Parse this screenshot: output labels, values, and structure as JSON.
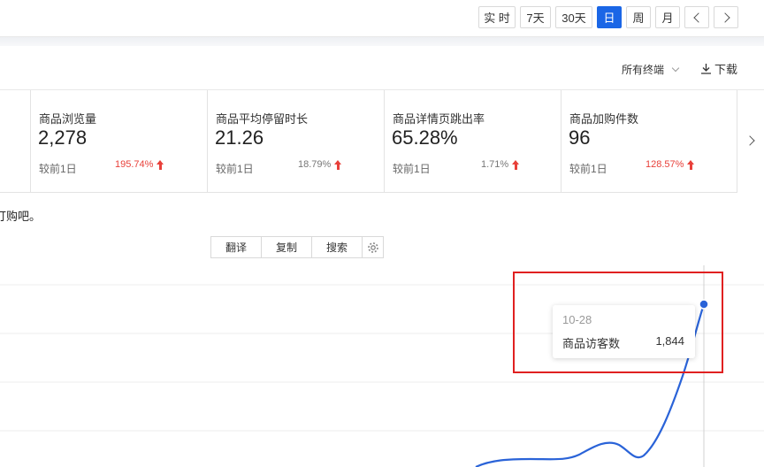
{
  "period_tabs": [
    {
      "label": "实 时",
      "active": false
    },
    {
      "label": "7天",
      "active": false
    },
    {
      "label": "30天",
      "active": false
    },
    {
      "label": "日",
      "active": true
    },
    {
      "label": "周",
      "active": false
    },
    {
      "label": "月",
      "active": false
    }
  ],
  "toolbar": {
    "terminal_select": "所有终端",
    "download_label": "下载"
  },
  "metrics": [
    {
      "title": "商品浏览量",
      "value": "2,278",
      "compare_label": "较前1日",
      "change": "195.74%",
      "trend": "up",
      "change_color": "#e8403a"
    },
    {
      "title": "商品平均停留时长",
      "value": "21.26",
      "compare_label": "较前1日",
      "change": "18.79%",
      "trend": "up",
      "change_color": "#777777"
    },
    {
      "title": "商品详情页跳出率",
      "value": "65.28%",
      "compare_label": "较前1日",
      "change": "1.71%",
      "trend": "up",
      "change_color": "#777777"
    },
    {
      "title": "商品加购件数",
      "value": "96",
      "compare_label": "较前1日",
      "change": "128.57%",
      "trend": "up",
      "change_color": "#e8403a"
    }
  ],
  "text_fragment": "订购吧。",
  "translate_bar": {
    "translate_label": "翻译",
    "copy_label": "复制",
    "search_label": "搜索"
  },
  "tooltip": {
    "date": "10-28",
    "series_label": "商品访客数",
    "value": "1,844"
  },
  "colors": {
    "accent": "#1a66e6",
    "increase": "#e8403a",
    "annotation_box": "#e02020"
  }
}
